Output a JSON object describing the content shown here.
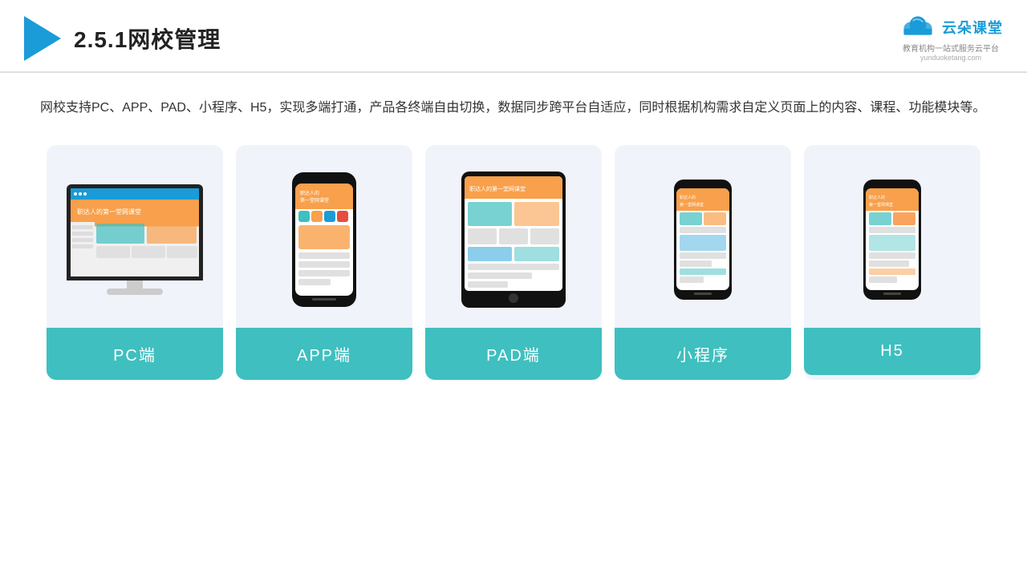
{
  "header": {
    "title": "2.5.1网校管理",
    "brand_name": "云朵课堂",
    "brand_url": "yunduoketang.com",
    "brand_tagline": "教育机构一站式服务云平台"
  },
  "description": "网校支持PC、APP、PAD、小程序、H5，实现多端打通，产品各终端自由切换，数据同步跨平台自适应，同时根据机构需求自定义页面上的内容、课程、功能模块等。",
  "cards": [
    {
      "id": "pc",
      "label": "PC端"
    },
    {
      "id": "app",
      "label": "APP端"
    },
    {
      "id": "pad",
      "label": "PAD端"
    },
    {
      "id": "miniprogram",
      "label": "小程序"
    },
    {
      "id": "h5",
      "label": "H5"
    }
  ]
}
